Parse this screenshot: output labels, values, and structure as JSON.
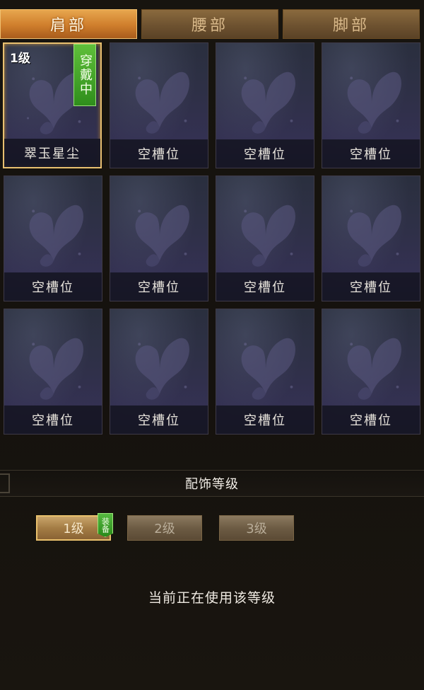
{
  "tabs": [
    {
      "label": "肩部",
      "active": true
    },
    {
      "label": "腰部",
      "active": false
    },
    {
      "label": "脚部",
      "active": false
    }
  ],
  "slots": [
    {
      "name": "翠玉星尘",
      "level": "1级",
      "badge": "穿戴中",
      "selected": true
    },
    {
      "name": "空槽位"
    },
    {
      "name": "空槽位"
    },
    {
      "name": "空槽位"
    },
    {
      "name": "空槽位"
    },
    {
      "name": "空槽位"
    },
    {
      "name": "空槽位"
    },
    {
      "name": "空槽位"
    },
    {
      "name": "空槽位"
    },
    {
      "name": "空槽位"
    },
    {
      "name": "空槽位"
    },
    {
      "name": "空槽位"
    }
  ],
  "section": {
    "title": "配饰等级"
  },
  "levels": [
    {
      "label": "1级",
      "active": true,
      "tag": "装备"
    },
    {
      "label": "2级",
      "active": false
    },
    {
      "label": "3级",
      "active": false
    }
  ],
  "status_text": "当前正在使用该等级",
  "colors": {
    "tab_active": "#cf7e2c",
    "wear_badge": "#3fa025",
    "selected_border": "#e8c070"
  }
}
